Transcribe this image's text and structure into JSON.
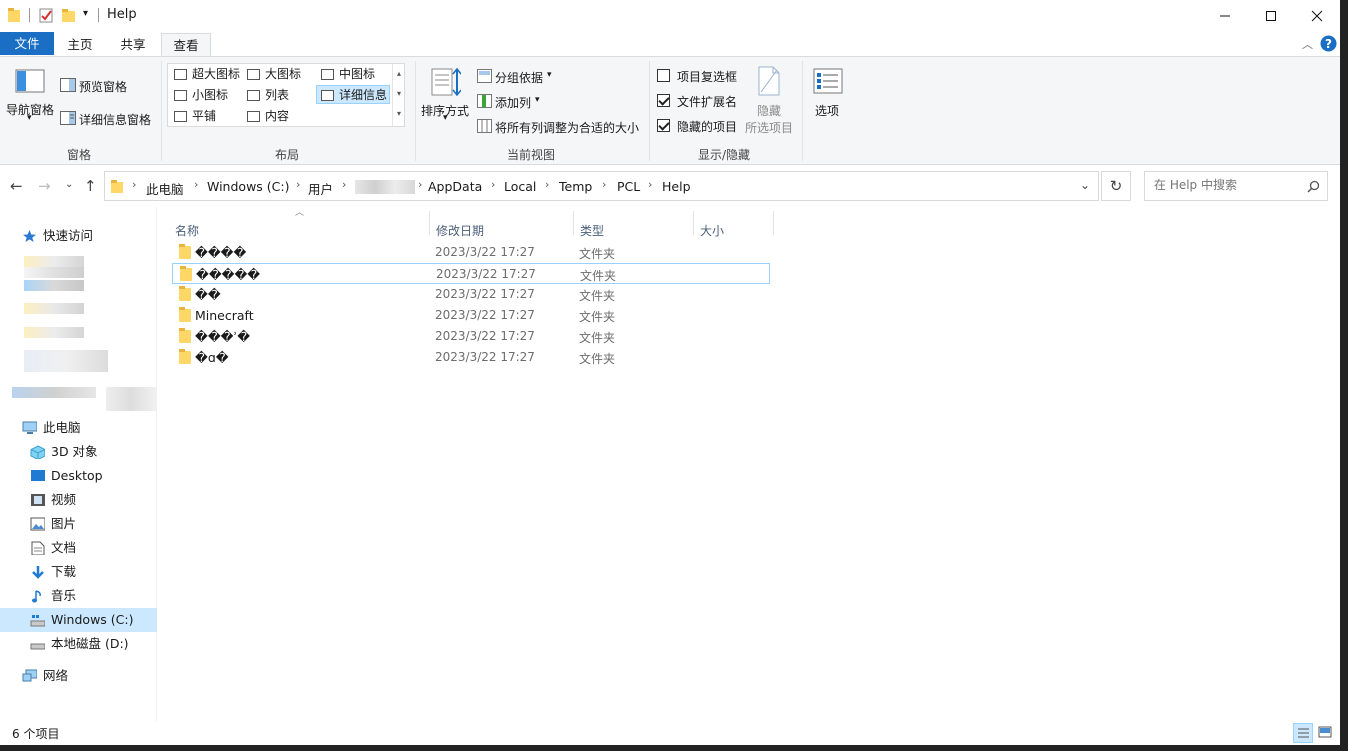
{
  "window": {
    "title": "Help"
  },
  "tabs": {
    "file": "文件",
    "home": "主页",
    "share": "共享",
    "view": "查看"
  },
  "ribbon": {
    "pane_group": {
      "nav_pane": "导航窗格",
      "preview_pane": "预览窗格",
      "details_pane": "详细信息窗格",
      "label": "窗格"
    },
    "layout_group": {
      "extra_large": "超大图标",
      "large": "大图标",
      "medium": "中图标",
      "small": "小图标",
      "list": "列表",
      "details": "详细信息",
      "tiles": "平铺",
      "content": "内容",
      "label": "布局"
    },
    "current_view_group": {
      "sort_by": "排序方式",
      "group_by": "分组依据",
      "add_column": "添加列",
      "size_all_columns": "将所有列调整为合适的大小",
      "label": "当前视图"
    },
    "show_hide_group": {
      "item_checkboxes": "项目复选框",
      "file_extensions": "文件扩展名",
      "hidden_items": "隐藏的项目",
      "hide": "隐藏",
      "selected_items": "所选项目",
      "label": "显示/隐藏",
      "item_checkboxes_checked": false,
      "file_extensions_checked": true,
      "hidden_items_checked": true
    },
    "options": "选项"
  },
  "address": {
    "crumbs": [
      "此电脑",
      "Windows (C:)",
      "用户",
      "AppData",
      "Local",
      "Temp",
      "PCL",
      "Help"
    ],
    "search_placeholder": "在 Help 中搜索"
  },
  "nav": {
    "quick_access": "快速访问",
    "this_pc": "此电脑",
    "items": [
      "3D 对象",
      "Desktop",
      "视频",
      "图片",
      "文档",
      "下载",
      "音乐",
      "Windows (C:)",
      "本地磁盘 (D:)"
    ],
    "network": "网络"
  },
  "columns": {
    "name": "名称",
    "modified": "修改日期",
    "type": "类型",
    "size": "大小"
  },
  "files": [
    {
      "name": "����",
      "date": "2023/3/22 17:27",
      "type": "文件夹"
    },
    {
      "name": "�����",
      "date": "2023/3/22 17:27",
      "type": "文件夹"
    },
    {
      "name": "��",
      "date": "2023/3/22 17:27",
      "type": "文件夹"
    },
    {
      "name": "Minecraft",
      "date": "2023/3/22 17:27",
      "type": "文件夹"
    },
    {
      "name": "���ʾ�",
      "date": "2023/3/22 17:27",
      "type": "文件夹"
    },
    {
      "name": "�ɑ�",
      "date": "2023/3/22 17:27",
      "type": "文件夹"
    }
  ],
  "status": {
    "item_count": "6 个项目"
  },
  "colors": {
    "accent": "#1a6fc4",
    "selection": "#cce8ff",
    "folder": "#ffd767"
  }
}
